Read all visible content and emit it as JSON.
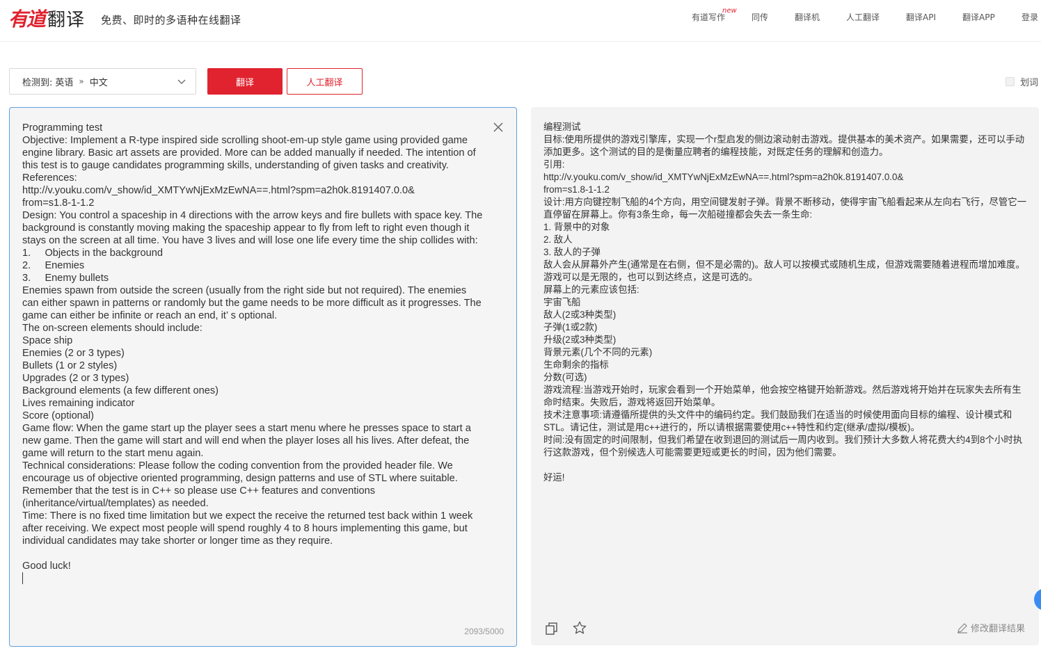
{
  "header": {
    "logo_you": "有道",
    "logo_fanyi": "翻译",
    "slogan": "免费、即时的多语种在线翻译",
    "nav": [
      {
        "label": "有道写作",
        "badge": "new"
      },
      {
        "label": "同传"
      },
      {
        "label": "翻译机"
      },
      {
        "label": "人工翻译"
      },
      {
        "label": "翻译API"
      },
      {
        "label": "翻译APP"
      },
      {
        "label": "登录"
      }
    ]
  },
  "toolbar": {
    "detected_label": "检测到:",
    "source_lang": "英语",
    "arrow": "»",
    "target_lang": "中文",
    "translate_label": "翻译",
    "human_translate_label": "人工翻译",
    "huaci_label": "划词"
  },
  "input": {
    "text": "Programming test\nObjective: Implement a R-type inspired side scrolling shoot-em-up style game using provided game engine library. Basic art assets are provided. More can be added manually if needed. The intention of this test is to gauge candidates programming skills, understanding of given tasks and creativity.\nReferences:\nhttp://v.youku.com/v_show/id_XMTYwNjExMzEwNA==.html?spm=a2h0k.8191407.0.0&\nfrom=s1.8-1-1.2\nDesign: You control a spaceship in 4 directions with the arrow keys and fire bullets with space key. The background is constantly moving making the spaceship appear to fly from left to right even though it stays on the screen at all time. You have 3 lives and will lose one life every time the ship collides with:\n1.     Objects in the background\n2.     Enemies\n3.     Enemy bullets\nEnemies spawn from outside the screen (usually from the right side but not required). The enemies can either spawn in patterns or randomly but the game needs to be more difficult as it progresses. The game can either be infinite or reach an end, it’ s optional.\nThe on-screen elements should include:\nSpace ship\nEnemies (2 or 3 types)\nBullets (1 or 2 styles)\nUpgrades (2 or 3 types)\nBackground elements (a few different ones)\nLives remaining indicator\nScore (optional)\nGame flow: When the game start up the player sees a start menu where he presses space to start a new game. Then the game will start and will end when the player loses all his lives. After defeat, the game will return to the start menu again.\nTechnical considerations: Please follow the coding convention from the provided header file. We encourage us of objective oriented programming, design patterns and use of STL where suitable. Remember that the test is in C++ so please use C++ features and conventions (inheritance/virtual/templates) as needed.\nTime: There is no fixed time limitation but we expect the receive the returned test back within 1 week after receiving. We expect most people will spend roughly 4 to 8 hours implementing this game, but individual candidates may take shorter or longer time as they require.\n\nGood luck!\n",
    "char_count": "2093/5000"
  },
  "output": {
    "text": "编程测试\n目标:使用所提供的游戏引擎库，实现一个r型启发的侧边滚动射击游戏。提供基本的美术资产。如果需要，还可以手动添加更多。这个测试的目的是衡量应聘者的编程技能，对既定任务的理解和创造力。\n引用:\nhttp://v.youku.com/v_show/id_XMTYwNjExMzEwNA==.html?spm=a2h0k.8191407.0.0&\nfrom=s1.8-1-1.2\n设计:用方向键控制飞船的4个方向，用空间键发射子弹。背景不断移动，使得宇宙飞船看起来从左向右飞行，尽管它一直停留在屏幕上。你有3条生命，每一次船碰撞都会失去一条生命:\n1. 背景中的对象\n2. 敌人\n3. 敌人的子弹\n敌人会从屏幕外产生(通常是在右侧，但不是必需的)。敌人可以按模式或随机生成，但游戏需要随着进程而增加难度。游戏可以是无限的，也可以到达终点，这是可选的。\n屏幕上的元素应该包括:\n宇宙飞船\n敌人(2或3种类型)\n子弹(1或2款)\n升级(2或3种类型)\n背景元素(几个不同的元素)\n生命剩余的指标\n分数(可选)\n游戏流程:当游戏开始时，玩家会看到一个开始菜单，他会按空格键开始新游戏。然后游戏将开始并在玩家失去所有生命时结束。失败后，游戏将返回开始菜单。\n技术注意事项:请遵循所提供的头文件中的编码约定。我们鼓励我们在适当的时候使用面向目标的编程、设计模式和STL。请记住，测试是用c++进行的，所以请根据需要使用c++特性和约定(继承/虚拟/模板)。\n时间:没有固定的时间限制，但我们希望在收到退回的测试后一周内收到。我们预计大多数人将花费大约4到8个小时执行这款游戏，但个别候选人可能需要更短或更长的时间，因为他们需要。\n\n好运!",
    "edit_label": "修改翻译结果"
  },
  "colors": {
    "brand_red": "#e0232f",
    "focus_blue": "#5c9fe0",
    "panel_bg": "#f5f5f5"
  }
}
